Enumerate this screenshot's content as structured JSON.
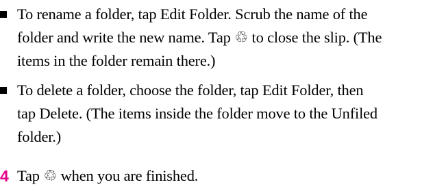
{
  "content": {
    "bullets": [
      {
        "text": "To rename a folder, tap Edit Folder. Scrub the name of the\nfolder and write the new name. Tap ♲ to close the slip. (The\nitems in the folder remain there.)"
      },
      {
        "text": "To delete a folder, choose the folder, tap Edit Folder, then\ntap Delete. (The items inside the folder move to the Unfiled\nfolder.)"
      }
    ],
    "step": {
      "number": "4",
      "text": "Tap ♲ when you are finished."
    }
  },
  "colors": {
    "step_number": "#e6008a",
    "text": "#000000"
  }
}
